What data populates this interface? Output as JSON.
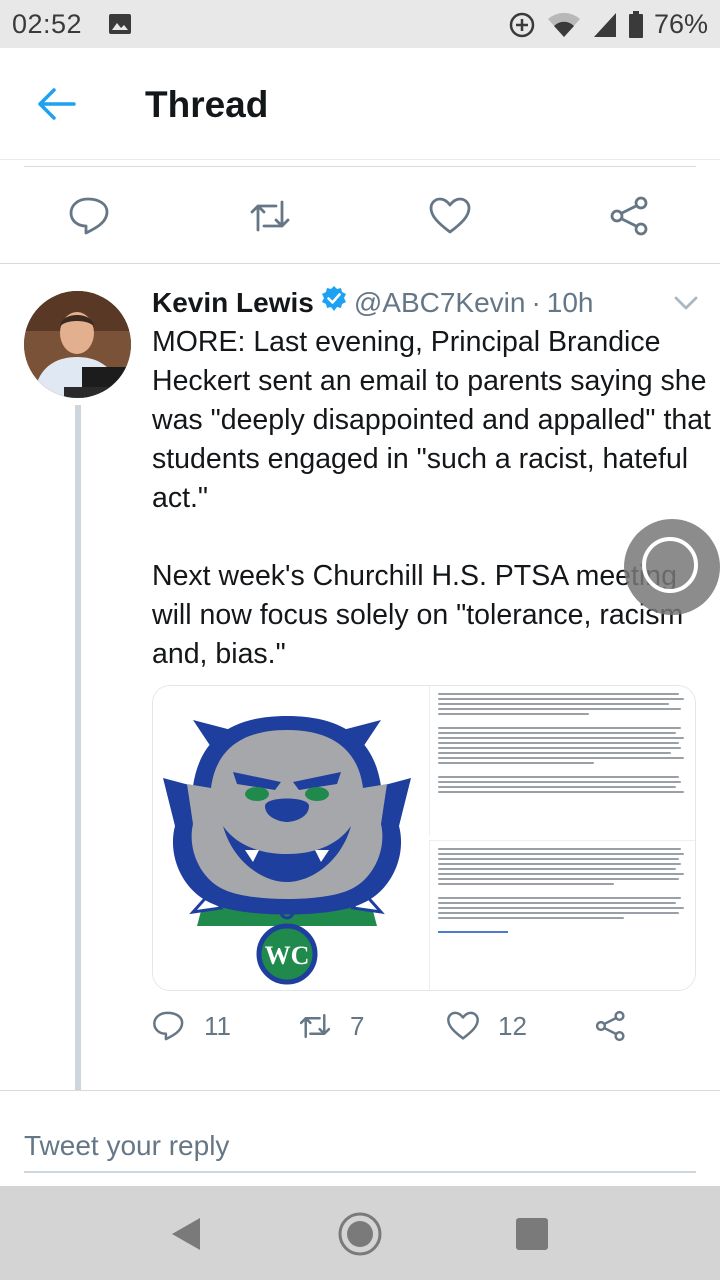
{
  "status_bar": {
    "time": "02:52",
    "battery": "76%",
    "icons": [
      "image-icon",
      "data-saver-icon",
      "wifi-icon",
      "signal-icon",
      "battery-icon"
    ]
  },
  "app_bar": {
    "title": "Thread",
    "back_icon": "arrow-left-icon"
  },
  "top_actions": [
    "reply-icon",
    "retweet-icon",
    "like-icon",
    "share-icon"
  ],
  "tweet": {
    "name": "Kevin Lewis",
    "handle": "@ABC7Kevin",
    "separator": "·",
    "time": "10h",
    "text": "MORE: Last evening, Principal Brandice Heckert sent an email to parents saying she was \"deeply disappointed and appalled\" that students engaged in \"such a racist, hateful act.\"\n\nNext week's Churchill H.S. PTSA meeting will now focus solely on \"tolerance, racism and, bias.\"",
    "media": {
      "logo_letters": "WC"
    },
    "counts": {
      "replies": "11",
      "retweets": "7",
      "likes": "12"
    }
  },
  "reply": {
    "placeholder": "Tweet your reply"
  },
  "colors": {
    "accent": "#1da1f2",
    "icon_gray": "#657786",
    "bulldog_blue": "#1f3f9e",
    "bulldog_green": "#1f8a4c"
  }
}
